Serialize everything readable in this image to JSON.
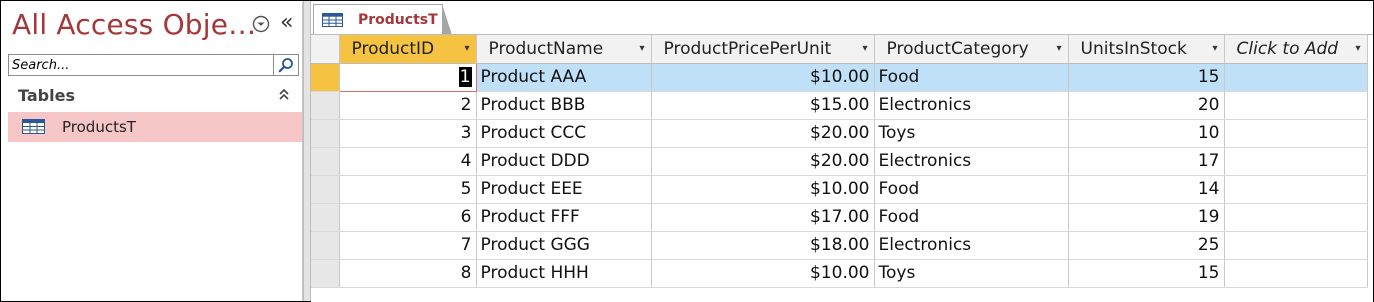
{
  "nav_pane": {
    "title": "All Access Obje…",
    "collapse_glyph": "«",
    "search": {
      "placeholder": "Search...",
      "value": ""
    },
    "group": {
      "label": "Tables",
      "chevron": "⌃"
    },
    "items": [
      {
        "label": "ProductsT",
        "icon": "table-icon"
      }
    ]
  },
  "document_tab": {
    "label": "ProductsT",
    "icon": "table-icon"
  },
  "datasheet": {
    "columns": [
      {
        "label": "ProductID",
        "dropdown": "▾"
      },
      {
        "label": "ProductName",
        "dropdown": "▾"
      },
      {
        "label": "ProductPricePerUnit",
        "dropdown": "▾"
      },
      {
        "label": "ProductCategory",
        "dropdown": "▾"
      },
      {
        "label": "UnitsInStock",
        "dropdown": "▾"
      },
      {
        "label": "Click to Add",
        "dropdown": "▾"
      }
    ],
    "rows": [
      {
        "id": "1",
        "name": "Product AAA",
        "price": "$10.00",
        "category": "Food",
        "stock": "15"
      },
      {
        "id": "2",
        "name": "Product BBB",
        "price": "$15.00",
        "category": "Electronics",
        "stock": "20"
      },
      {
        "id": "3",
        "name": "Product CCC",
        "price": "$20.00",
        "category": "Toys",
        "stock": "10"
      },
      {
        "id": "4",
        "name": "Product DDD",
        "price": "$20.00",
        "category": "Electronics",
        "stock": "17"
      },
      {
        "id": "5",
        "name": "Product EEE",
        "price": "$10.00",
        "category": "Food",
        "stock": "14"
      },
      {
        "id": "6",
        "name": "Product FFF",
        "price": "$17.00",
        "category": "Food",
        "stock": "19"
      },
      {
        "id": "7",
        "name": "Product GGG",
        "price": "$18.00",
        "category": "Electronics",
        "stock": "25"
      },
      {
        "id": "8",
        "name": "Product HHH",
        "price": "$10.00",
        "category": "Toys",
        "stock": "15"
      }
    ]
  },
  "colors": {
    "accent_title": "#a4373a",
    "selected_nav_item": "#f7c7c8",
    "active_header": "#f5c242",
    "selected_row": "#bfe0f7"
  }
}
